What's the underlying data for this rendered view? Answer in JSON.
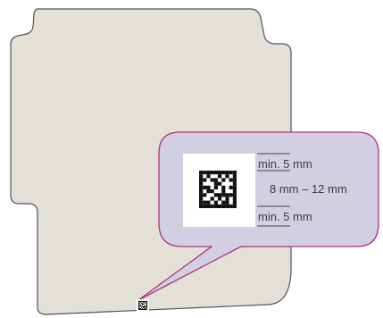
{
  "colors": {
    "envelope_fill": "#e3e1d7",
    "envelope_stroke": "#555555",
    "bubble_fill": "#d3cfe2",
    "bubble_stroke": "#b2307a",
    "code_fill": "#ffffff",
    "code_dark": "#111111",
    "rule": "#444444",
    "text": "#3c3c3c"
  },
  "callout": {
    "label_top": "min. 5 mm",
    "label_middle": "8 mm – 12 mm",
    "label_bottom": "min. 5 mm"
  },
  "icons": {
    "data_matrix": "data-matrix-code-icon",
    "data_matrix_small": "data-matrix-code-icon-small"
  }
}
